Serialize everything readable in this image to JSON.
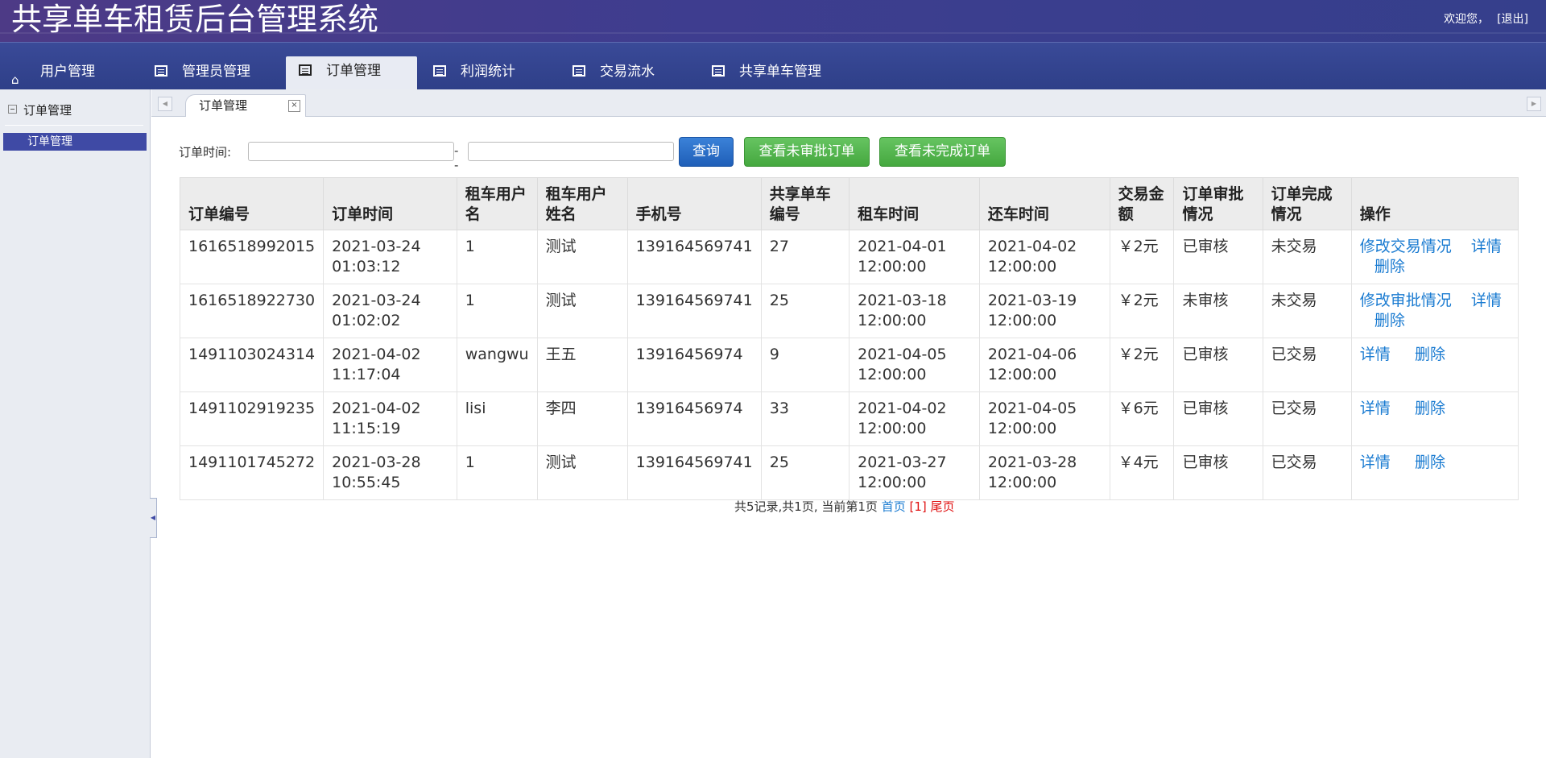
{
  "header": {
    "title": "共享单车租赁后台管理系统",
    "welcome": "欢迎您，",
    "logout": "[退出]"
  },
  "nav": {
    "tabs": [
      {
        "label": "用户管理",
        "icon": "home-icon"
      },
      {
        "label": "管理员管理",
        "icon": "list-icon"
      },
      {
        "label": "订单管理",
        "icon": "list-icon"
      },
      {
        "label": "利润统计",
        "icon": "list-icon"
      },
      {
        "label": "交易流水",
        "icon": "list-icon"
      },
      {
        "label": "共享单车管理",
        "icon": "list-icon"
      }
    ],
    "active_index": 2
  },
  "sidebar": {
    "group_label": "订单管理",
    "items": [
      {
        "label": "订单管理"
      }
    ]
  },
  "content_tab": {
    "label": "订单管理",
    "close": "×"
  },
  "search": {
    "label": "订单时间:",
    "from_value": "",
    "to_value": "",
    "separator": "--",
    "query_button": "查询",
    "unapproved_button": "查看未审批订单",
    "unfinished_button": "查看未完成订单"
  },
  "table": {
    "headers": [
      "订单编号",
      "订单时间",
      "租车用户名",
      "租车用户姓名",
      "手机号",
      "共享单车编号",
      "租车时间",
      "还车时间",
      "交易金额",
      "订单审批情况",
      "订单完成情况",
      "操作"
    ],
    "rows": [
      {
        "id": "1616518992015",
        "order_time": "2021-03-24 01:03:12",
        "username": "1",
        "name": "测试",
        "phone": "139164569741",
        "bike": "27",
        "rent_time": "2021-04-01 12:00:00",
        "return_time": "2021-04-02 12:00:00",
        "amount": "￥2元",
        "approval": "已审核",
        "completion": "未交易",
        "actions": [
          "修改交易情况",
          "详情",
          "删除"
        ]
      },
      {
        "id": "1616518922730",
        "order_time": "2021-03-24 01:02:02",
        "username": "1",
        "name": "测试",
        "phone": "139164569741",
        "bike": "25",
        "rent_time": "2021-03-18 12:00:00",
        "return_time": "2021-03-19 12:00:00",
        "amount": "￥2元",
        "approval": "未审核",
        "completion": "未交易",
        "actions": [
          "修改审批情况",
          "详情",
          "删除"
        ]
      },
      {
        "id": "1491103024314",
        "order_time": "2021-04-02 11:17:04",
        "username": "wangwu",
        "name": "王五",
        "phone": "13916456974",
        "bike": "9",
        "rent_time": "2021-04-05 12:00:00",
        "return_time": "2021-04-06 12:00:00",
        "amount": "￥2元",
        "approval": "已审核",
        "completion": "已交易",
        "actions": [
          "详情",
          "删除"
        ]
      },
      {
        "id": "1491102919235",
        "order_time": "2021-04-02 11:15:19",
        "username": "lisi",
        "name": "李四",
        "phone": "13916456974",
        "bike": "33",
        "rent_time": "2021-04-02 12:00:00",
        "return_time": "2021-04-05 12:00:00",
        "amount": "￥6元",
        "approval": "已审核",
        "completion": "已交易",
        "actions": [
          "详情",
          "删除"
        ]
      },
      {
        "id": "1491101745272",
        "order_time": "2021-03-28 10:55:45",
        "username": "1",
        "name": "测试",
        "phone": "139164569741",
        "bike": "25",
        "rent_time": "2021-03-27 12:00:00",
        "return_time": "2021-03-28 12:00:00",
        "amount": "￥4元",
        "approval": "已审核",
        "completion": "已交易",
        "actions": [
          "详情",
          "删除"
        ]
      }
    ]
  },
  "pager": {
    "summary": "共5记录,共1页, 当前第1页",
    "first": "首页",
    "current": "[1]",
    "last": "尾页"
  },
  "colors": {
    "header_bg": "#4d3a86",
    "nav_bg": "#2e3f88",
    "sidebar_active": "#3f4aa5",
    "link": "#1a7bd1",
    "btn_blue": "#1f5fb8",
    "btn_green": "#45a83f"
  }
}
